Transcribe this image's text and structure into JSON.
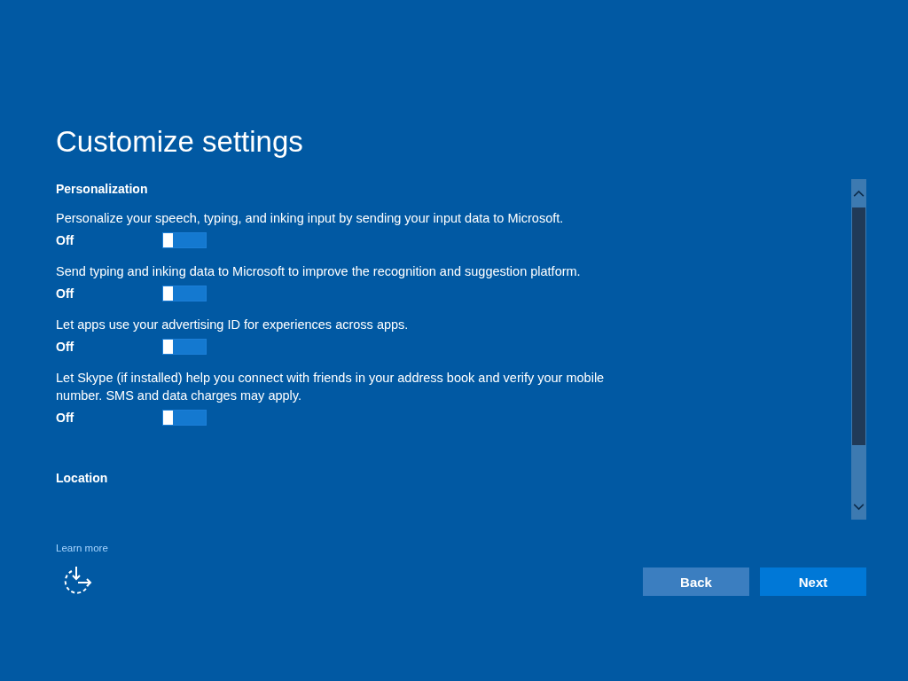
{
  "title": "Customize settings",
  "sections": [
    {
      "heading": "Personalization",
      "settings": [
        {
          "description": "Personalize your speech, typing, and inking input by sending your input data to Microsoft.",
          "state_label": "Off",
          "on": false
        },
        {
          "description": "Send typing and inking data to Microsoft to improve the recognition and suggestion platform.",
          "state_label": "Off",
          "on": false
        },
        {
          "description": "Let apps use your advertising ID for experiences across apps.",
          "state_label": "Off",
          "on": false
        },
        {
          "description": "Let Skype (if installed) help you connect with friends in your address book and verify your mobile number. SMS and data charges may apply.",
          "state_label": "Off",
          "on": false
        }
      ]
    },
    {
      "heading": "Location"
    }
  ],
  "learn_more": "Learn more",
  "buttons": [
    {
      "label": "Back",
      "kind": "secondary"
    },
    {
      "label": "Next",
      "kind": "primary"
    }
  ]
}
